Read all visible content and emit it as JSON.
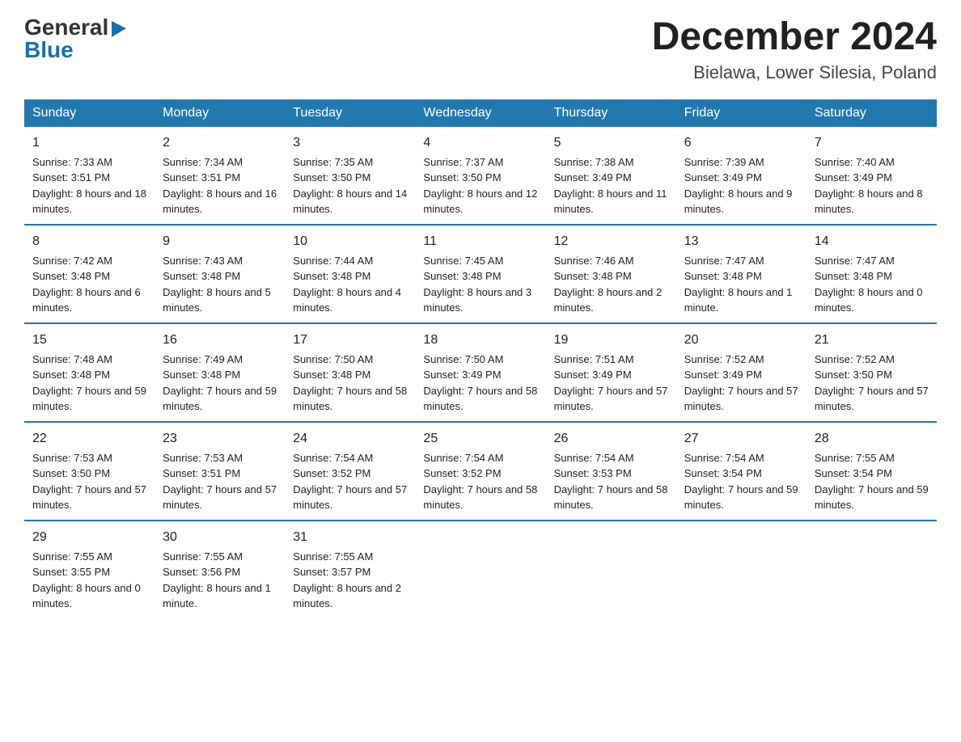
{
  "logo": {
    "general": "General",
    "blue": "Blue",
    "arrow": "▶"
  },
  "header": {
    "month_year": "December 2024",
    "location": "Bielawa, Lower Silesia, Poland"
  },
  "days_of_week": [
    "Sunday",
    "Monday",
    "Tuesday",
    "Wednesday",
    "Thursday",
    "Friday",
    "Saturday"
  ],
  "weeks": [
    [
      {
        "day": "1",
        "sunrise": "7:33 AM",
        "sunset": "3:51 PM",
        "daylight": "8 hours and 18 minutes."
      },
      {
        "day": "2",
        "sunrise": "7:34 AM",
        "sunset": "3:51 PM",
        "daylight": "8 hours and 16 minutes."
      },
      {
        "day": "3",
        "sunrise": "7:35 AM",
        "sunset": "3:50 PM",
        "daylight": "8 hours and 14 minutes."
      },
      {
        "day": "4",
        "sunrise": "7:37 AM",
        "sunset": "3:50 PM",
        "daylight": "8 hours and 12 minutes."
      },
      {
        "day": "5",
        "sunrise": "7:38 AM",
        "sunset": "3:49 PM",
        "daylight": "8 hours and 11 minutes."
      },
      {
        "day": "6",
        "sunrise": "7:39 AM",
        "sunset": "3:49 PM",
        "daylight": "8 hours and 9 minutes."
      },
      {
        "day": "7",
        "sunrise": "7:40 AM",
        "sunset": "3:49 PM",
        "daylight": "8 hours and 8 minutes."
      }
    ],
    [
      {
        "day": "8",
        "sunrise": "7:42 AM",
        "sunset": "3:48 PM",
        "daylight": "8 hours and 6 minutes."
      },
      {
        "day": "9",
        "sunrise": "7:43 AM",
        "sunset": "3:48 PM",
        "daylight": "8 hours and 5 minutes."
      },
      {
        "day": "10",
        "sunrise": "7:44 AM",
        "sunset": "3:48 PM",
        "daylight": "8 hours and 4 minutes."
      },
      {
        "day": "11",
        "sunrise": "7:45 AM",
        "sunset": "3:48 PM",
        "daylight": "8 hours and 3 minutes."
      },
      {
        "day": "12",
        "sunrise": "7:46 AM",
        "sunset": "3:48 PM",
        "daylight": "8 hours and 2 minutes."
      },
      {
        "day": "13",
        "sunrise": "7:47 AM",
        "sunset": "3:48 PM",
        "daylight": "8 hours and 1 minute."
      },
      {
        "day": "14",
        "sunrise": "7:47 AM",
        "sunset": "3:48 PM",
        "daylight": "8 hours and 0 minutes."
      }
    ],
    [
      {
        "day": "15",
        "sunrise": "7:48 AM",
        "sunset": "3:48 PM",
        "daylight": "7 hours and 59 minutes."
      },
      {
        "day": "16",
        "sunrise": "7:49 AM",
        "sunset": "3:48 PM",
        "daylight": "7 hours and 59 minutes."
      },
      {
        "day": "17",
        "sunrise": "7:50 AM",
        "sunset": "3:48 PM",
        "daylight": "7 hours and 58 minutes."
      },
      {
        "day": "18",
        "sunrise": "7:50 AM",
        "sunset": "3:49 PM",
        "daylight": "7 hours and 58 minutes."
      },
      {
        "day": "19",
        "sunrise": "7:51 AM",
        "sunset": "3:49 PM",
        "daylight": "7 hours and 57 minutes."
      },
      {
        "day": "20",
        "sunrise": "7:52 AM",
        "sunset": "3:49 PM",
        "daylight": "7 hours and 57 minutes."
      },
      {
        "day": "21",
        "sunrise": "7:52 AM",
        "sunset": "3:50 PM",
        "daylight": "7 hours and 57 minutes."
      }
    ],
    [
      {
        "day": "22",
        "sunrise": "7:53 AM",
        "sunset": "3:50 PM",
        "daylight": "7 hours and 57 minutes."
      },
      {
        "day": "23",
        "sunrise": "7:53 AM",
        "sunset": "3:51 PM",
        "daylight": "7 hours and 57 minutes."
      },
      {
        "day": "24",
        "sunrise": "7:54 AM",
        "sunset": "3:52 PM",
        "daylight": "7 hours and 57 minutes."
      },
      {
        "day": "25",
        "sunrise": "7:54 AM",
        "sunset": "3:52 PM",
        "daylight": "7 hours and 58 minutes."
      },
      {
        "day": "26",
        "sunrise": "7:54 AM",
        "sunset": "3:53 PM",
        "daylight": "7 hours and 58 minutes."
      },
      {
        "day": "27",
        "sunrise": "7:54 AM",
        "sunset": "3:54 PM",
        "daylight": "7 hours and 59 minutes."
      },
      {
        "day": "28",
        "sunrise": "7:55 AM",
        "sunset": "3:54 PM",
        "daylight": "7 hours and 59 minutes."
      }
    ],
    [
      {
        "day": "29",
        "sunrise": "7:55 AM",
        "sunset": "3:55 PM",
        "daylight": "8 hours and 0 minutes."
      },
      {
        "day": "30",
        "sunrise": "7:55 AM",
        "sunset": "3:56 PM",
        "daylight": "8 hours and 1 minute."
      },
      {
        "day": "31",
        "sunrise": "7:55 AM",
        "sunset": "3:57 PM",
        "daylight": "8 hours and 2 minutes."
      },
      null,
      null,
      null,
      null
    ]
  ]
}
